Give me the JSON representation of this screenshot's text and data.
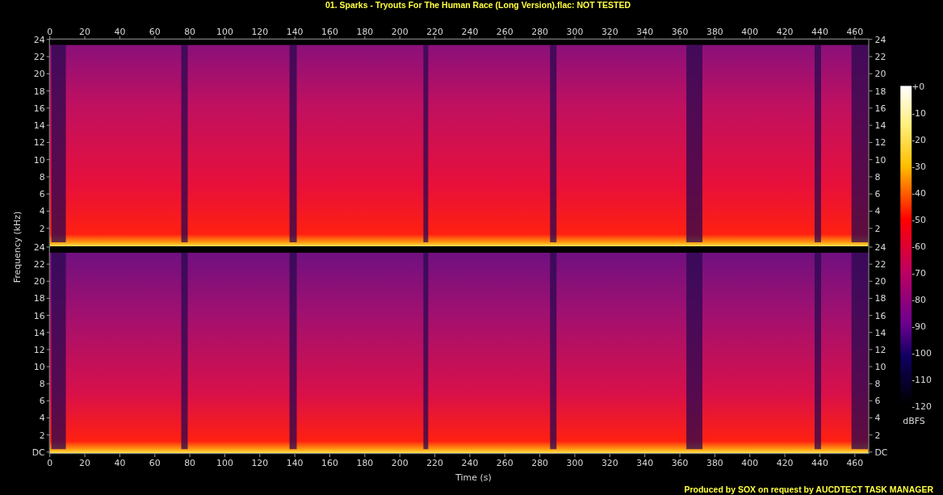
{
  "title": "01. Sparks - Tryouts For The Human Race (Long Version).flac: NOT TESTED",
  "x_axis": {
    "label": "Time (s)",
    "top_ticks": [
      "0",
      "20",
      "40",
      "60",
      "80",
      "100",
      "120",
      "140",
      "160",
      "180",
      "200",
      "220",
      "240",
      "260",
      "280",
      "300",
      "320",
      "340",
      "360",
      "380",
      "400",
      "420",
      "440",
      "460"
    ],
    "bottom_ticks": [
      "0",
      "20",
      "40",
      "60",
      "80",
      "100",
      "120",
      "140",
      "160",
      "180",
      "200",
      "220",
      "240",
      "260",
      "280",
      "300",
      "320",
      "340",
      "360",
      "380",
      "400",
      "420",
      "440",
      "460"
    ]
  },
  "y_axis": {
    "label": "Frequency (kHz)",
    "channels": [
      {
        "left_ticks": [
          "24",
          "22",
          "20",
          "18",
          "16",
          "14",
          "12",
          "10",
          "8",
          "6",
          "4",
          "2"
        ],
        "right_ticks": [
          "24",
          "22",
          "20",
          "18",
          "16",
          "14",
          "12",
          "10",
          "8",
          "6",
          "4",
          "2"
        ]
      },
      {
        "left_ticks": [
          "24",
          "22",
          "20",
          "18",
          "16",
          "14",
          "12",
          "10",
          "8",
          "6",
          "4",
          "2",
          "DC"
        ],
        "right_ticks": [
          "24",
          "22",
          "20",
          "18",
          "16",
          "14",
          "12",
          "10",
          "8",
          "6",
          "4",
          "2",
          "DC"
        ]
      }
    ]
  },
  "color_scale": {
    "unit": "dBFS",
    "ticks": [
      "+0",
      "-10",
      "-20",
      "-30",
      "-40",
      "-50",
      "-60",
      "-70",
      "-80",
      "-90",
      "-100",
      "-110",
      "-120"
    ]
  },
  "footer": "Produced by SOX on request by AUCDTECT TASK MANAGER"
}
